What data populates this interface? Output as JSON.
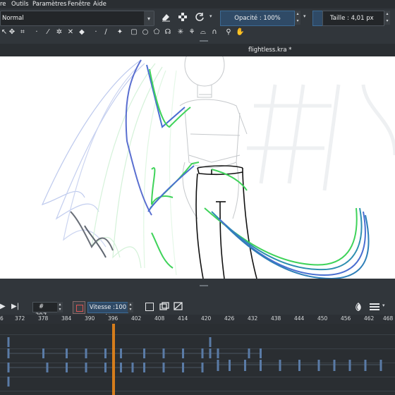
{
  "menubar": {
    "items": [
      "re",
      "Outils",
      "Paramètres",
      "Fenêtre",
      "Aide"
    ]
  },
  "toolbar": {
    "blend_mode": "Normal",
    "opacity_label": "Opacité : 100%",
    "size_label": "Taille : 4,01 px"
  },
  "document": {
    "tab_title": "flightless.kra *"
  },
  "timeline": {
    "frame_prefix": "#",
    "current_frame": "397",
    "speed_label": "Vitesse :100 %",
    "ruler_ticks": [
      "6",
      "372",
      "378",
      "384",
      "390",
      "396",
      "402",
      "408",
      "414",
      "420",
      "426",
      "432",
      "438",
      "444",
      "450",
      "456",
      "462",
      "468"
    ],
    "playhead_frame": 397
  },
  "colors": {
    "accent": "#3daee9",
    "playhead": "#e8861a",
    "keyframe": "#5a7ba6",
    "stroke_green": "#3fd35a",
    "stroke_blue": "#4a6fd1",
    "stroke_teal": "#2e8fb0"
  },
  "icons": {
    "toolbar1": [
      "brush-preset-icon",
      "eraser-icon",
      "alpha-lock-icon",
      "reload-icon"
    ],
    "toolbar2": [
      "select-shapes-icon",
      "move-icon",
      "crop-icon",
      "eyedropper-icon",
      "smart-patch-icon",
      "fill-icon",
      "multibrush-icon",
      "assistant-icon",
      "rect-select-icon",
      "ellipse-select-icon",
      "polygon-select-icon",
      "freehand-select-icon",
      "contiguous-select-icon",
      "color-select-icon",
      "bezier-select-icon",
      "magnetic-select-icon",
      "zoom-icon",
      "pan-icon"
    ],
    "timeline": [
      "play-next-icon",
      "onion-skin-icon",
      "add-frame-icon",
      "duplicate-frame-icon",
      "remove-frame-icon",
      "onion-skin-settings-icon",
      "hamburger-icon"
    ]
  }
}
